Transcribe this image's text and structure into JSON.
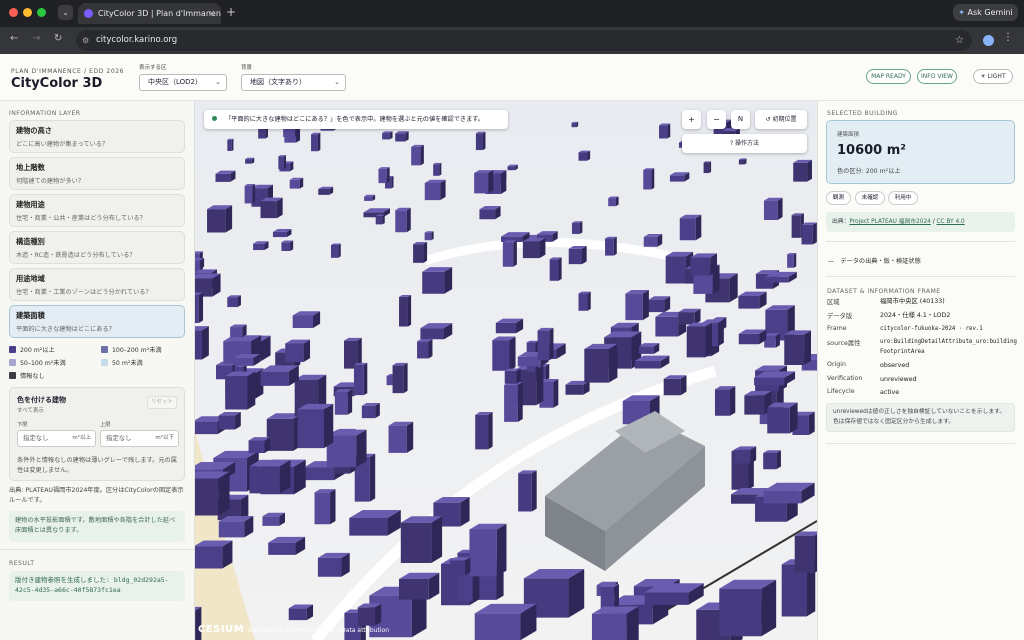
{
  "browser": {
    "tab_title": "CityColor 3D | Plan d'Immanence",
    "url": "citycolor.karino.org",
    "ask_gemini": "Ask Gemini"
  },
  "header": {
    "eyebrow": "PLAN D'IMMANENCE / EDD 2026",
    "title": "CityColor 3D",
    "district_label": "表示する区",
    "district_value": "中央区（LOD2）",
    "basemap_label": "背景",
    "basemap_value": "地図（文字あり）",
    "map_ready": "MAP READY",
    "info_view": "INFO VIEW",
    "light": "LIGHT"
  },
  "left": {
    "section": "INFORMATION LAYER",
    "layers": [
      {
        "title": "建物の高さ",
        "sub": "どこに高い建物が集まっている？"
      },
      {
        "title": "地上階数",
        "sub": "何階建ての建物が多い？"
      },
      {
        "title": "建物用途",
        "sub": "住宅・商業・公共・産業はどう分布している？"
      },
      {
        "title": "構造種別",
        "sub": "木造・RC造・鉄骨造はどう分布している？"
      },
      {
        "title": "用途地域",
        "sub": "住宅・商業・工業のゾーンはどう分かれている？"
      },
      {
        "title": "建築面積",
        "sub": "平面的に大きな建物はどこにある？"
      }
    ],
    "legend": [
      {
        "label": "200 m²以上",
        "color": "#4b3f8a"
      },
      {
        "label": "100–200 m²未満",
        "color": "#6a72a8"
      },
      {
        "label": "50–100 m²未満",
        "color": "#a7a7cf"
      },
      {
        "label": "50 m²未満",
        "color": "#c7dcea"
      },
      {
        "label": "情報なし",
        "color": "#3a3d42"
      }
    ],
    "filter": {
      "title": "色を付ける建物",
      "sub": "すべて表示",
      "reset": "リセット",
      "lower_label": "下限",
      "upper_label": "上限",
      "lower_placeholder": "指定なし",
      "lower_unit": "m²以上",
      "upper_placeholder": "指定なし",
      "upper_unit": "m²以下",
      "note": "条件外と情報なしの建物は薄いグレーで残します。元の属性は変更しません。"
    },
    "source_note": "出典: PLATEAU福岡市2024年度。区分はCityColorの固定表示ルールです。",
    "info_note": "建物の水平投影面積です。敷地面積や各階を合計した延べ床面積とは異なります。",
    "result_section": "RESULT",
    "result_text": "版付き建物参照を生成しました: bldg_02d292a5-42c5-4d35-a66c-40f5873fc1ea"
  },
  "map": {
    "hint": "「平面的に大きな建物はどこにある？」を色で表示中。建物を選ぶと元の値を確認できます。",
    "zoom_in": "+",
    "zoom_out": "−",
    "north": "N",
    "reset_view": "↺ 初期位置",
    "help": "? 操作方法",
    "attribution": "Upgrade for commercial use. | Data attribution",
    "cesium": "CESIUM"
  },
  "right": {
    "section": "SELECTED BUILDING",
    "area_label": "建築面積",
    "area_value": "10600 m²",
    "area_class": "色の区分: 200 m²以上",
    "tags": [
      "観測",
      "未確認",
      "利用中"
    ],
    "source_prefix": "出典：",
    "source_link1": "Project PLATEAU 福岡市2024",
    "source_sep": " / ",
    "source_link2": "CC BY 4.0",
    "provenance": "—　データの出典・版・検証状態",
    "dataset_section": "DATASET & INFORMATION FRAME",
    "meta": [
      {
        "k": "区域",
        "v": "福岡市中央区 (40133)"
      },
      {
        "k": "データ版",
        "v": "2024・仕様 4.1・LOD2"
      },
      {
        "k": "Frame",
        "v": "citycolor-fukuoka-2024 · rev.1"
      },
      {
        "k": "source属性",
        "v": "uro:BuildingDetailAttribute_uro:buildingFootprintArea"
      },
      {
        "k": "Origin",
        "v": "observed"
      },
      {
        "k": "Verification",
        "v": "unreviewed"
      },
      {
        "k": "Lifecycle",
        "v": "active"
      }
    ],
    "unreviewed_note": "unreviewedは値の正しさを独自検証していないことを示します。色は保存値ではなく固定区分から生成します。"
  }
}
